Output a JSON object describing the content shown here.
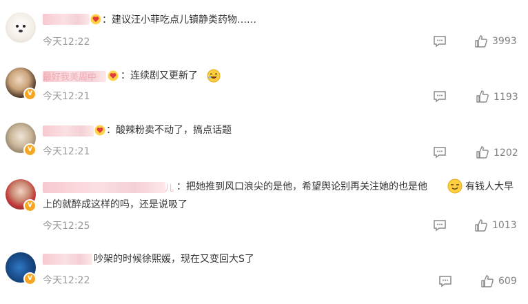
{
  "colors": {
    "text": "#333333",
    "meta": "#999999",
    "verified": "#f5a623"
  },
  "comments": [
    {
      "text": "：建议汪小菲吃点儿镇静类药物……",
      "time": "今天12:22",
      "likes": "3993"
    },
    {
      "name_fragment": "最好我美周中",
      "text": "：连续剧又更新了",
      "time": "今天12:21",
      "likes": "1193"
    },
    {
      "text": "：酸辣粉卖不动了，搞点话题",
      "time": "今天12:21",
      "likes": "1202"
    },
    {
      "name_fragment": "儿",
      "text_line1": "：把她推到风口浪尖的是他，希望舆论别再关注她的也是他",
      "text_line1b": "有钱人大早",
      "text_line2": "上的就醉成这样的吗，还是说吸了",
      "time": "今天12:25",
      "likes": "1013"
    },
    {
      "text": "吵架的时候徐熙媛，现在又变回大S了",
      "time": "今天12:22",
      "likes": "609"
    }
  ],
  "icons": {
    "comment": "comment-icon",
    "like": "thumbs-up-icon",
    "verified": "verified-badge-icon",
    "emoji_laugh": "laughing-emoji",
    "emoji_smirk": "smirk-emoji",
    "fan_badge": "heart-badge-icon"
  }
}
